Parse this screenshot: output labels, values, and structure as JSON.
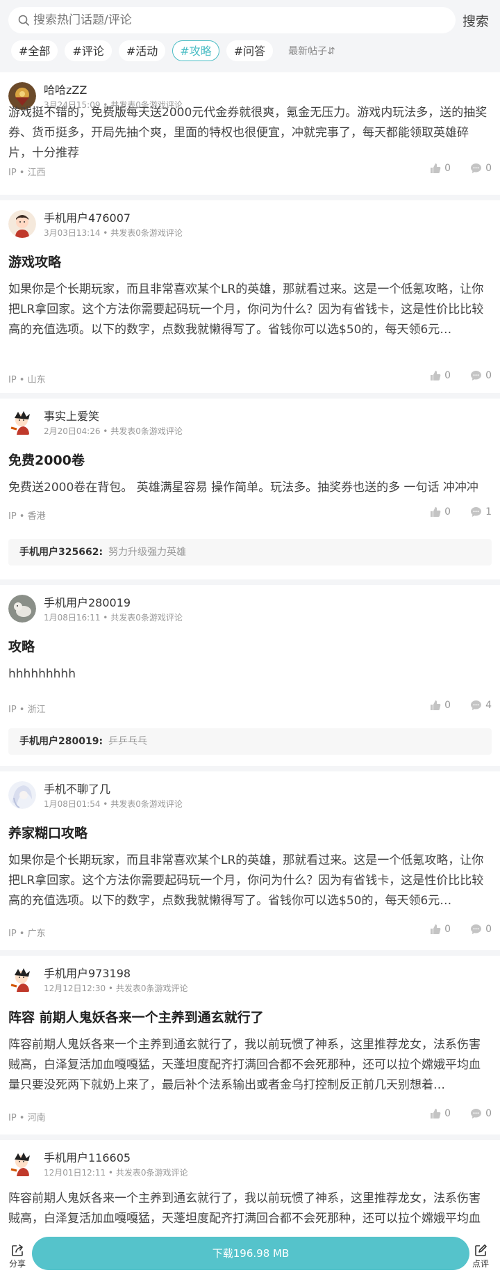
{
  "search": {
    "placeholder": "搜索热门话题/评论",
    "button": "搜索"
  },
  "tabs": [
    "#全部",
    "#评论",
    "#活动",
    "#攻略",
    "#问答"
  ],
  "active_tab": "#攻略",
  "sort_label": "最新帖子⇵",
  "accent_color": "#4bbdc5",
  "posts": [
    {
      "user": "哈哈zZZ",
      "meta": "3月24日15:09 • 共发表0条游戏评论",
      "title": "",
      "content": "游戏挺不错的，免费版每天送2000元代金券就很爽，氪金无压力。游戏内玩法多，送的抽奖券、货币挺多，开局先抽个爽，里面的特权也很便宜，冲就完事了，每天都能领取英雄碎片，十分推荐",
      "ip": "IP • 江西",
      "likes": "0",
      "comments": "0",
      "reply": null
    },
    {
      "user": "手机用户476007",
      "meta": "3月03日13:14 • 共发表0条游戏评论",
      "title": "游戏攻略",
      "content": "如果你是个长期玩家，而且非常喜欢某个LR的英雄，那就看过来。这是一个低氪攻略，让你把LR拿回家。这个方法你需要起码玩一个月，你问为什么？因为有省钱卡，这是性价比比较高的充值选项。以下的数字，点数我就懒得写了。省钱你可以选$50的，每天领6元…",
      "ip": "IP • 山东",
      "likes": "0",
      "comments": "0",
      "reply": null
    },
    {
      "user": "事实上爱笑",
      "meta": "2月20日04:26 • 共发表0条游戏评论",
      "title": "免费2000卷",
      "content": "免费送2000卷在背包。 英雄满星容易 操作简单。玩法多。抽奖券也送的多 一句话 冲冲冲",
      "ip": "IP • 香港",
      "likes": "0",
      "comments": "1",
      "reply": {
        "user": "手机用户325662:",
        "text": "努力升级强力英雄"
      }
    },
    {
      "user": "手机用户280019",
      "meta": "1月08日16:11 • 共发表0条游戏评论",
      "title": "攻略",
      "content": "hhhhhhhhh",
      "ip": "IP • 浙江",
      "likes": "0",
      "comments": "4",
      "reply": {
        "user": "手机用户280019:",
        "text": "乒乒乓乓"
      }
    },
    {
      "user": "手机不聊了几",
      "meta": "1月08日01:54 • 共发表0条游戏评论",
      "title": "养家糊口攻略",
      "content": "如果你是个长期玩家，而且非常喜欢某个LR的英雄，那就看过来。这是一个低氪攻略，让你把LR拿回家。这个方法你需要起码玩一个月，你问为什么？因为有省钱卡，这是性价比比较高的充值选项。以下的数字，点数我就懒得写了。省钱你可以选$50的，每天领6元…",
      "ip": "IP • 广东",
      "likes": "0",
      "comments": "0",
      "reply": null
    },
    {
      "user": "手机用户973198",
      "meta": "12月12日12:30 • 共发表0条游戏评论",
      "title": "阵容 前期人鬼妖各来一个主养到通玄就行了",
      "content": "阵容前期人鬼妖各来一个主养到通玄就行了，我以前玩惯了神系，这里推荐龙女，法系伤害贼高，白泽复活加血嘎嘎猛，天蓬坦度配齐打满回合都不会死那种，还可以拉个嫦娥平均血量只要没死两下就奶上来了，最后补个法系输出或者金乌打控制反正前几天别想着…",
      "ip": "IP • 河南",
      "likes": "0",
      "comments": "0",
      "reply": null
    },
    {
      "user": "手机用户116605",
      "meta": "12月01日12:11 • 共发表0条游戏评论",
      "title": "",
      "content": "阵容前期人鬼妖各来一个主养到通玄就行了，我以前玩惯了神系，这里推荐龙女，法系伤害贼高，白泽复活加血嘎嘎猛，天蓬坦度配齐打满回合都不会死那种，还可以拉个嫦娥平均血量只要没死两下就奶上来了",
      "ip": "",
      "likes": "",
      "comments": "",
      "reply": null
    }
  ],
  "bottom": {
    "share": "分享",
    "download": "下载196.98 MB",
    "review": "点评"
  }
}
